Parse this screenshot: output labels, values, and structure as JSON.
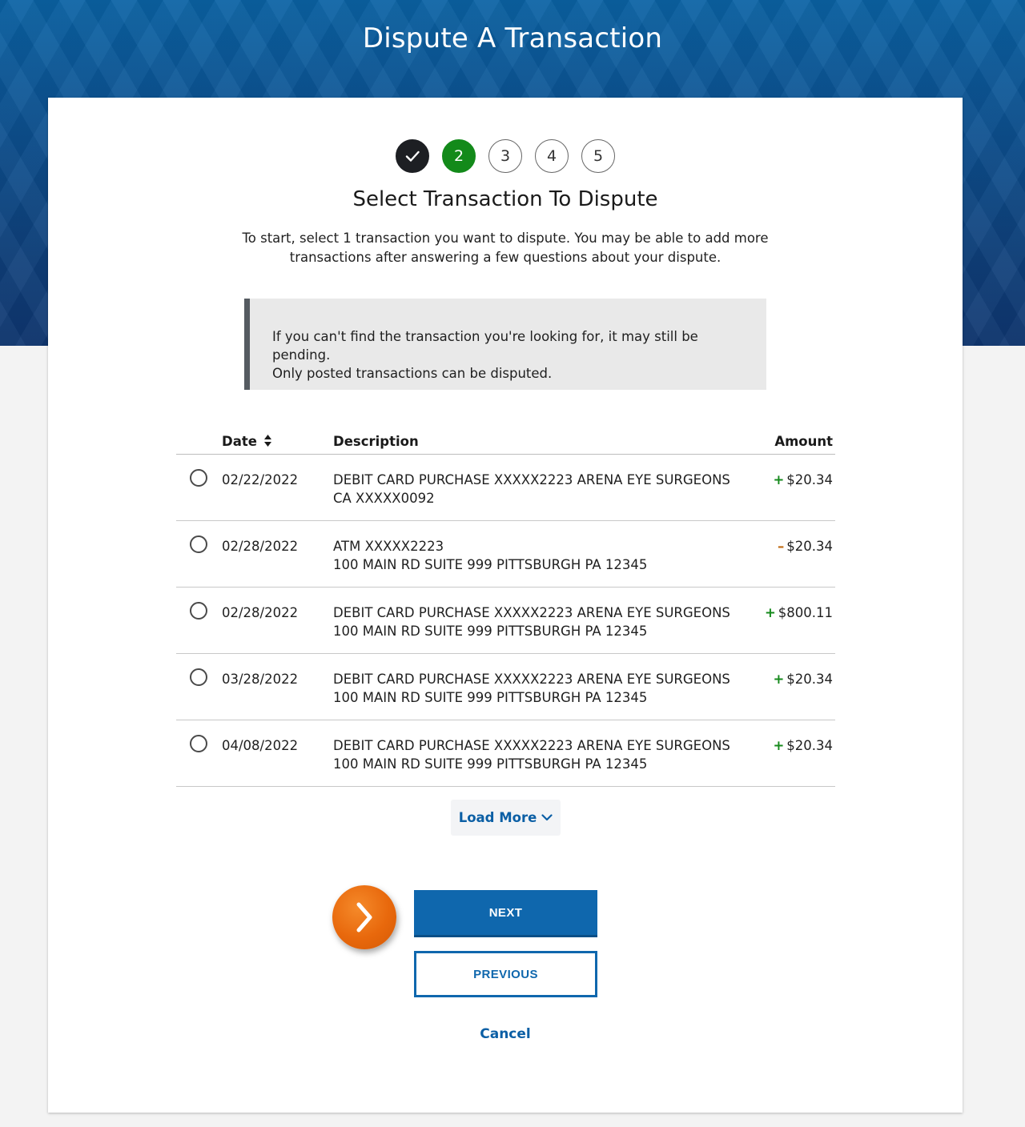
{
  "page": {
    "title": "Dispute A Transaction"
  },
  "stepper": {
    "steps": [
      {
        "label": "",
        "state": "complete",
        "icon": "checkmark-icon"
      },
      {
        "label": "2",
        "state": "current"
      },
      {
        "label": "3",
        "state": "upcoming"
      },
      {
        "label": "4",
        "state": "upcoming"
      },
      {
        "label": "5",
        "state": "upcoming"
      }
    ]
  },
  "step": {
    "title": "Select Transaction To Dispute",
    "intro": "To start, select 1 transaction you want to dispute. You may be able to add more transactions after answering a few questions about your dispute."
  },
  "notice": {
    "line1": "If you can't find the transaction you're looking for, it may still be pending.",
    "line2": "Only posted transactions can be disputed."
  },
  "table": {
    "headers": {
      "date": "Date",
      "description": "Description",
      "amount": "Amount"
    },
    "rows": [
      {
        "date": "02/22/2022",
        "desc1": "DEBIT CARD PURCHASE XXXXX2223 ARENA EYE SURGEONS",
        "desc2": "CA XXXXX0092",
        "sign": "+",
        "amount": "$20.34",
        "selected": false
      },
      {
        "date": "02/28/2022",
        "desc1": "ATM XXXXX2223",
        "desc2": "100 MAIN RD SUITE 999  PITTSBURGH PA 12345",
        "sign": "–",
        "amount": "$20.34",
        "selected": false
      },
      {
        "date": "02/28/2022",
        "desc1": "DEBIT CARD PURCHASE XXXXX2223 ARENA EYE SURGEONS",
        "desc2": "100 MAIN RD SUITE 999  PITTSBURGH PA 12345",
        "sign": "+",
        "amount": "$800.11",
        "selected": false
      },
      {
        "date": "03/28/2022",
        "desc1": "DEBIT CARD PURCHASE XXXXX2223 ARENA EYE SURGEONS",
        "desc2": "100 MAIN RD SUITE 999  PITTSBURGH PA 12345",
        "sign": "+",
        "amount": "$20.34",
        "selected": false
      },
      {
        "date": "04/08/2022",
        "desc1": "DEBIT CARD PURCHASE XXXXX2223 ARENA EYE SURGEONS",
        "desc2": "100 MAIN RD SUITE 999  PITTSBURGH PA 12345",
        "sign": "+",
        "amount": "$20.34",
        "selected": false
      }
    ]
  },
  "actions": {
    "load_more": "Load More",
    "next": "NEXT",
    "previous": "PREVIOUS",
    "cancel": "Cancel"
  },
  "colors": {
    "brand_blue": "#0f67ad",
    "step_complete": "#1d1f23",
    "step_current": "#138a1a",
    "amount_credit": "#168a1c",
    "amount_debit": "#c06b12",
    "hint_orange": "#e8680c"
  },
  "icons": {
    "sort": "sort-icon",
    "load_more": "chevron-down-icon",
    "hint": "chevron-right-icon",
    "step_complete": "checkmark-icon"
  }
}
